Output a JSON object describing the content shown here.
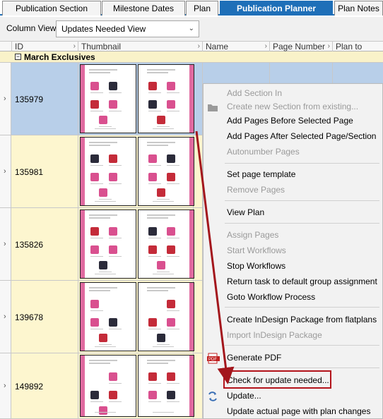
{
  "tabs": [
    {
      "label": "Publication Section",
      "active": false
    },
    {
      "label": "Milestone Dates",
      "active": false
    },
    {
      "label": "Plan",
      "active": false
    },
    {
      "label": "Publication Planner",
      "active": true
    },
    {
      "label": "Plan Notes",
      "active": false
    }
  ],
  "column_view": {
    "label": "Column View:",
    "selected": "Updates Needed View"
  },
  "grid": {
    "columns": [
      "ID",
      "Thumbnail",
      "Name",
      "Page Number",
      "Plan to Actual"
    ],
    "group": {
      "title": "March Exclusives",
      "toggle": "−"
    },
    "rows": [
      {
        "id": "135979",
        "selected": true
      },
      {
        "id": "135981",
        "selected": false
      },
      {
        "id": "135826",
        "selected": false
      },
      {
        "id": "139678",
        "selected": false
      },
      {
        "id": "149892",
        "selected": false
      }
    ]
  },
  "context_menu": {
    "items": [
      {
        "label": "Add Section In",
        "enabled": false
      },
      {
        "label": "Create new Section from existing...",
        "enabled": false,
        "icon": "folder-icon"
      },
      {
        "label": "Add Pages Before Selected Page",
        "enabled": true
      },
      {
        "label": "Add Pages After Selected Page/Section",
        "enabled": true
      },
      {
        "label": "Autonumber Pages",
        "enabled": false
      },
      {
        "label": "Set page template",
        "enabled": true
      },
      {
        "label": "Remove Pages",
        "enabled": false
      },
      {
        "label": "View Plan",
        "enabled": true
      },
      {
        "label": "Assign Pages",
        "enabled": false
      },
      {
        "label": "Start Workflows",
        "enabled": false
      },
      {
        "label": "Stop Workflows",
        "enabled": true
      },
      {
        "label": "Return task to default group assignment",
        "enabled": true
      },
      {
        "label": "Goto Workflow Process",
        "enabled": true
      },
      {
        "label": "Create InDesign Package from flatplans",
        "enabled": true
      },
      {
        "label": "Import InDesign Package",
        "enabled": false
      },
      {
        "label": "Generate PDF",
        "enabled": true,
        "icon": "pdf-icon",
        "icon_text": "PDF"
      },
      {
        "label": "Check for update needed...",
        "enabled": true,
        "highlighted": true
      },
      {
        "label": "Update...",
        "enabled": true,
        "icon": "update-icon"
      },
      {
        "label": "Update actual page with plan changes",
        "enabled": true
      }
    ]
  },
  "colors": {
    "tab_active": "#1e6fb8",
    "row_bg": "#fdf6cf",
    "row_selected": "#b8cfe9",
    "highlight_border": "#b3131b",
    "arrow": "#a3161c"
  }
}
